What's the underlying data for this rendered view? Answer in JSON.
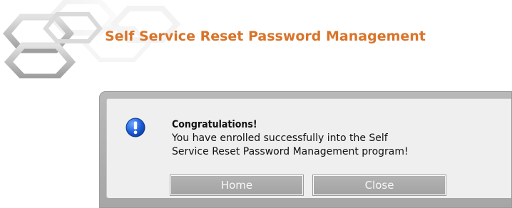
{
  "header": {
    "title": "Self Service Reset Password Management"
  },
  "dialog": {
    "icon": "info-icon",
    "title": "Congratulations!",
    "message_line1": "You have enrolled successfully into the Self",
    "message_line2": "Service Reset Password Management program!",
    "buttons": {
      "home_label": "Home",
      "close_label": "Close"
    }
  },
  "colors": {
    "title_orange": "#d9742a",
    "icon_blue": "#1a5bd6",
    "dialog_frame": "#b0b0b0",
    "button_gray": "#ababab"
  }
}
